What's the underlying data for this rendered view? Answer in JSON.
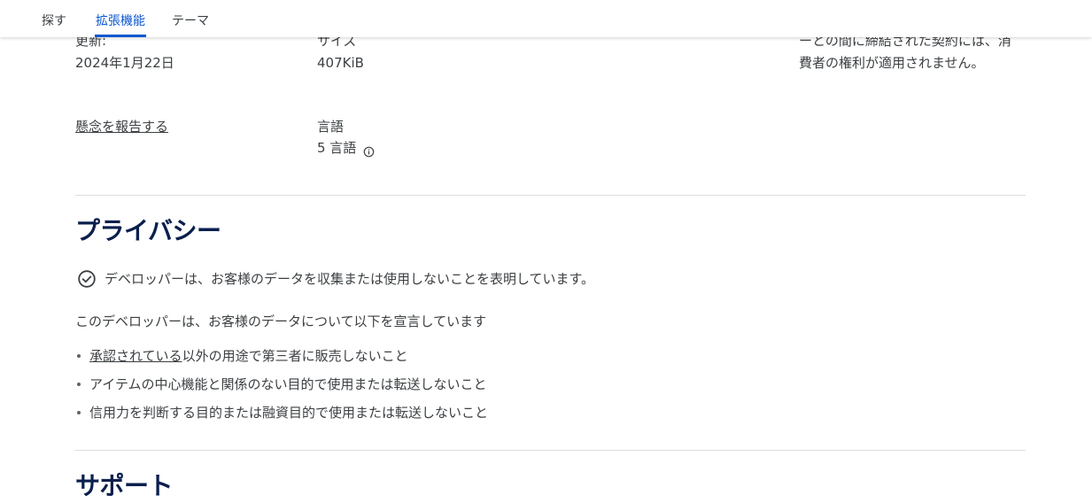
{
  "nav": {
    "tabs": [
      {
        "label": "探す"
      },
      {
        "label": "拡張機能"
      },
      {
        "label": "テーマ"
      }
    ]
  },
  "details": {
    "updated_label": "更新:",
    "updated_value": "2024年1月22日",
    "size_label": "サイズ",
    "size_value": "407KiB",
    "language_label": "言語",
    "language_value": "5 言語",
    "report_link": "懸念を報告する",
    "consumer_text": "ーとの間に締結された契約には、消費者の権利が適用されません。"
  },
  "privacy": {
    "heading": "プライバシー",
    "statement": "デベロッパーは、お客様のデータを収集または使用しないことを表明しています。",
    "declaration": "このデベロッパーは、お客様のデータについて以下を宣言しています",
    "items": [
      {
        "link": "承認されている",
        "text": "以外の用途で第三者に販売しないこと"
      },
      {
        "text": "アイテムの中心機能と関係のない目的で使用または転送しないこと"
      },
      {
        "text": "信用力を判断する目的または融資目的で使用または転送しないこと"
      }
    ]
  },
  "support": {
    "heading": "サポート"
  },
  "colors": {
    "accent": "#0b57d0",
    "heading": "#0b1f4d",
    "text": "#3c4043",
    "divider": "#dadce0"
  },
  "icons": {
    "info": "info-icon",
    "privacy_check": "check-circle-icon"
  }
}
